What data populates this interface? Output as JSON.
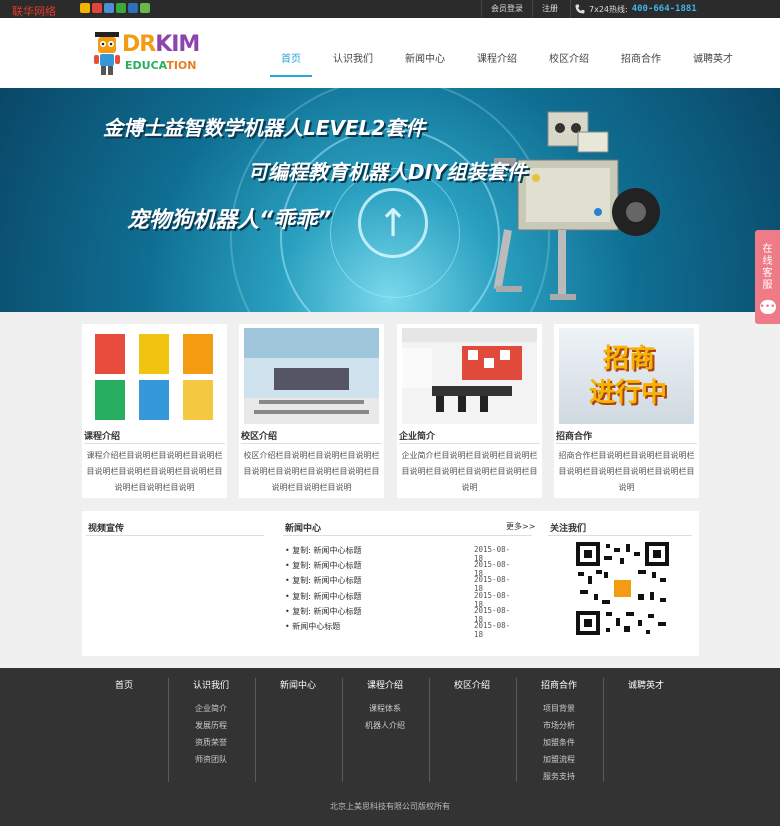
{
  "topbar": {
    "brand_text": "联华网络",
    "share_icons": [
      {
        "name": "qzone-icon",
        "color": "#f4b400"
      },
      {
        "name": "weibo-icon",
        "color": "#e0453a"
      },
      {
        "name": "tencent-weibo-icon",
        "color": "#4a90d9"
      },
      {
        "name": "wechat-icon",
        "color": "#3aa83a"
      },
      {
        "name": "renren-icon",
        "color": "#2e6fb7"
      },
      {
        "name": "more-share-icon",
        "color": "#6bb84a"
      }
    ],
    "login_label": "会员登录",
    "register_label": "注册",
    "hotline_label": "7x24热线:",
    "hotline_number": "400-664-1881"
  },
  "logo": {
    "word1a": "DR",
    "word1b": "KIM",
    "word2a": "EDUCA",
    "word2b": "TION"
  },
  "nav": {
    "items": [
      "首页",
      "认识我们",
      "新闻中心",
      "课程介绍",
      "校区介绍",
      "招商合作",
      "诚聘英才"
    ],
    "active_index": 0,
    "accent_color": "#2ba6d9"
  },
  "banner": {
    "line1": "金博士益智数学机器人LEVEL2套件",
    "line2": "可编程教育机器人DIY组装套件",
    "line3": "宠物狗机器人“乖乖”"
  },
  "sidetab": {
    "label1": "在",
    "label2": "线",
    "label3": "客",
    "label4": "服",
    "bubble": "•••"
  },
  "cards": [
    {
      "title": "课程介绍",
      "desc": "课程介绍栏目说明栏目说明栏目说明栏目说明栏目说明栏目说明栏目说明栏目说明栏目说明栏目说明"
    },
    {
      "title": "校区介绍",
      "desc": "校区介绍栏目说明栏目说明栏目说明栏目说明栏目说明栏目说明栏目说明栏目说明栏目说明栏目说明"
    },
    {
      "title": "企业简介",
      "desc": "企业简介栏目说明栏目说明栏目说明栏目说明栏目说明栏目说明栏目说明栏目说明"
    },
    {
      "title": "招商合作",
      "desc": "招商合作栏目说明栏目说明栏目说明栏目说明栏目说明栏目说明栏目说明栏目说明"
    }
  ],
  "card_images": {
    "card4_text1": "招商",
    "card4_text2": "进行中"
  },
  "panel": {
    "video_title": "视频宣传",
    "news_title": "新闻中心",
    "more_label": "更多>>",
    "follow_title": "关注我们",
    "news": [
      {
        "title": "• 复制: 新闻中心标题",
        "date": "2015-08-18"
      },
      {
        "title": "• 复制: 新闻中心标题",
        "date": "2015-08-18"
      },
      {
        "title": "• 复制: 新闻中心标题",
        "date": "2015-08-18"
      },
      {
        "title": "• 复制: 新闻中心标题",
        "date": "2015-08-18"
      },
      {
        "title": "• 复制: 新闻中心标题",
        "date": "2015-08-18"
      },
      {
        "title": "• 新闻中心标题",
        "date": "2015-08-18"
      }
    ]
  },
  "footer": {
    "columns": [
      {
        "head": "首页",
        "items": []
      },
      {
        "head": "认识我们",
        "items": [
          "企业简介",
          "发展历程",
          "资质荣誉",
          "师资团队"
        ]
      },
      {
        "head": "新闻中心",
        "items": []
      },
      {
        "head": "课程介绍",
        "items": [
          "课程体系",
          "机器人介绍"
        ]
      },
      {
        "head": "校区介绍",
        "items": []
      },
      {
        "head": "招商合作",
        "items": [
          "项目背景",
          "市场分析",
          "加盟条件",
          "加盟流程",
          "服务支持"
        ]
      },
      {
        "head": "诚聘英才",
        "items": []
      }
    ],
    "copyright": "北京上美思科技有限公司版权所有"
  }
}
